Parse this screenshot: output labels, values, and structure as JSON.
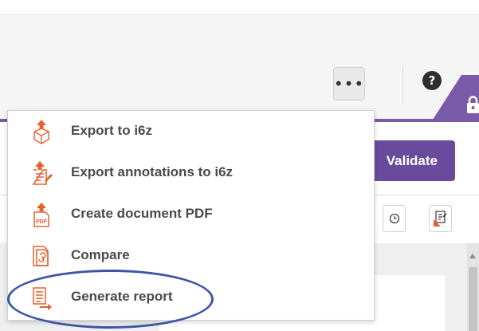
{
  "toolbar": {
    "more_label": "•••",
    "help_label": "?",
    "validate_label": "Validate"
  },
  "menu": {
    "items": [
      {
        "label": "Export to i6z",
        "icon": "export-i6z-icon"
      },
      {
        "label": "Export annotations to i6z",
        "icon": "export-annotations-icon"
      },
      {
        "label": "Create document PDF",
        "icon": "pdf-icon",
        "icon_text": "PDF"
      },
      {
        "label": "Compare",
        "icon": "compare-icon"
      },
      {
        "label": "Generate report",
        "icon": "report-icon"
      }
    ]
  },
  "colors": {
    "accent_purple": "#6a4a9c",
    "icon_orange": "#e8602c",
    "highlight_ring": "#3c55a5"
  }
}
